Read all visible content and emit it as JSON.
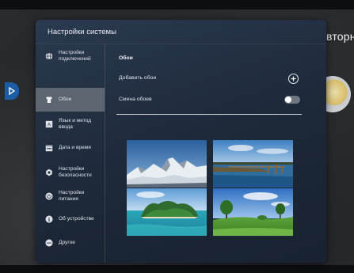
{
  "background": {
    "partial_text": "вторн"
  },
  "window": {
    "title": "Настройки системы"
  },
  "sidebar": {
    "items": [
      {
        "label": "Настройки\nподключений",
        "icon": "globe-icon",
        "active": false
      },
      {
        "label": "Обои",
        "icon": "shirt-icon",
        "active": true
      },
      {
        "label": "Язык и метод\nввода",
        "icon": "keyboard-letter-icon",
        "active": false
      },
      {
        "label": "Дата и время",
        "icon": "calendar-icon",
        "active": false
      },
      {
        "label": "Настройки\nбезопасности",
        "icon": "shield-gear-icon",
        "active": false
      },
      {
        "label": "Настройки\nпитания",
        "icon": "power-icon",
        "active": false
      },
      {
        "label": "Об устройстве",
        "icon": "info-icon",
        "active": false
      },
      {
        "label": "Другое",
        "icon": "more-icon",
        "active": false
      }
    ]
  },
  "wallpaper": {
    "section_title": "Обои",
    "add_label": "Добавить обои",
    "change_label": "Смена обоев",
    "change_enabled": false,
    "thumbnails": [
      {
        "subject": "snowy-mountains"
      },
      {
        "subject": "lake-pier-sunset"
      },
      {
        "subject": "tropical-island"
      },
      {
        "subject": "green-meadow-trees"
      }
    ]
  },
  "colors": {
    "window_bg": "#1d2838",
    "active_item": "#5d6670",
    "accent_blue": "#1d5da8"
  }
}
